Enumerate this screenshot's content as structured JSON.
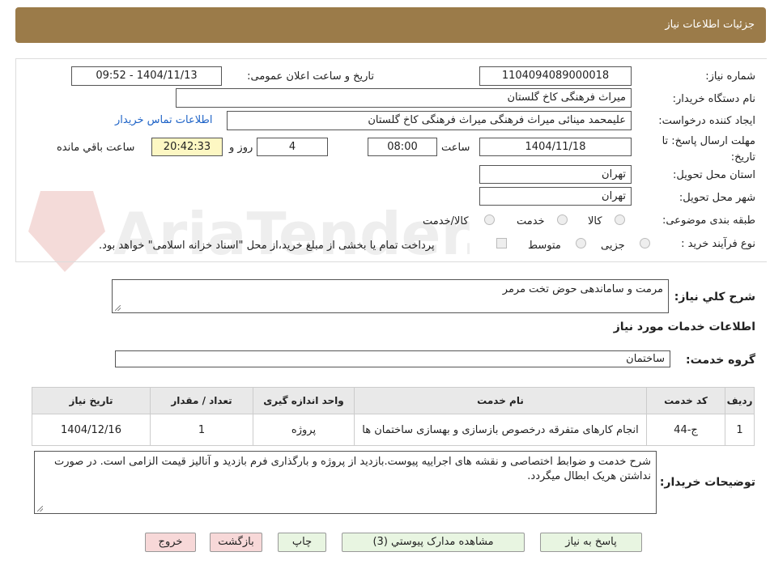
{
  "header": {
    "title": "جزئیات اطلاعات نیاز"
  },
  "fields": {
    "need_number_label": "شماره نیاز:",
    "need_number": "1104094089000018",
    "announce_label": "تاریخ و ساعت اعلان عمومی:",
    "announce_value": "1404/11/13 - 09:52",
    "buyer_org_label": "نام دستگاه خریدار:",
    "buyer_org": "میراث فرهنگی کاخ گلستان",
    "creator_label": "ایجاد کننده درخواست:",
    "creator": "علیمحمد مینائی میراث فرهنگی میراث فرهنگی کاخ گلستان",
    "contact_link": "اطلاعات تماس خریدار",
    "deadline_label": "مهلت ارسال پاسخ: تا تاریخ:",
    "deadline_date": "1404/11/18",
    "time_label": "ساعت",
    "deadline_time": "08:00",
    "days_value": "4",
    "days_label": "روز و",
    "remaining_time": "20:42:33",
    "remaining_label": "ساعت باقي مانده",
    "province_label": "استان محل تحویل:",
    "province": "تهران",
    "city_label": "شهر محل تحویل:",
    "city": "تهران",
    "category_label": "طبقه بندی موضوعی:",
    "category_options": [
      "کالا",
      "خدمت",
      "کالا/خدمت"
    ],
    "process_label": "نوع فرآیند خرید :",
    "process_options": [
      "جزیی",
      "متوسط"
    ],
    "payment_note": "پرداخت تمام یا بخشی از مبلغ خرید،از محل \"اسناد خزانه اسلامی\" خواهد بود."
  },
  "summary": {
    "label": "شرح کلي نياز:",
    "value": "مرمت و ساماندهی حوض تخت مرمر"
  },
  "services": {
    "section_title": "اطلاعات خدمات مورد نياز",
    "group_label": "گروه خدمت:",
    "group_value": "ساختمان",
    "columns": [
      "ردیف",
      "کد خدمت",
      "نام خدمت",
      "واحد اندازه گیری",
      "تعداد / مقدار",
      "تاریخ نیاز"
    ],
    "rows": [
      {
        "row": "1",
        "code": "ج-44",
        "name": "انجام کارهای متفرقه درخصوص بازسازی و بهسازی ساختمان ها",
        "unit": "پروژه",
        "qty": "1",
        "date": "1404/12/16"
      }
    ]
  },
  "buyer_notes": {
    "label": "توضیحات خریدار:",
    "value": "شرح خدمت و ضوابط اختصاصی و نقشه های اجراییه پیوست.بازدید از پروژه و بارگذاری فرم بازدید و آنالیز قیمت الزامی است. در صورت نداشتن هریک ابطال میگردد."
  },
  "buttons": {
    "respond": "پاسخ به نیاز",
    "attachments": "مشاهده مدارک پیوستي (3)",
    "print": "چاپ",
    "back": "بازگشت",
    "exit": "خروج"
  },
  "colors": {
    "header": "#9b7b49",
    "time_bg": "#fdf7c3",
    "link": "#1e63c7"
  }
}
